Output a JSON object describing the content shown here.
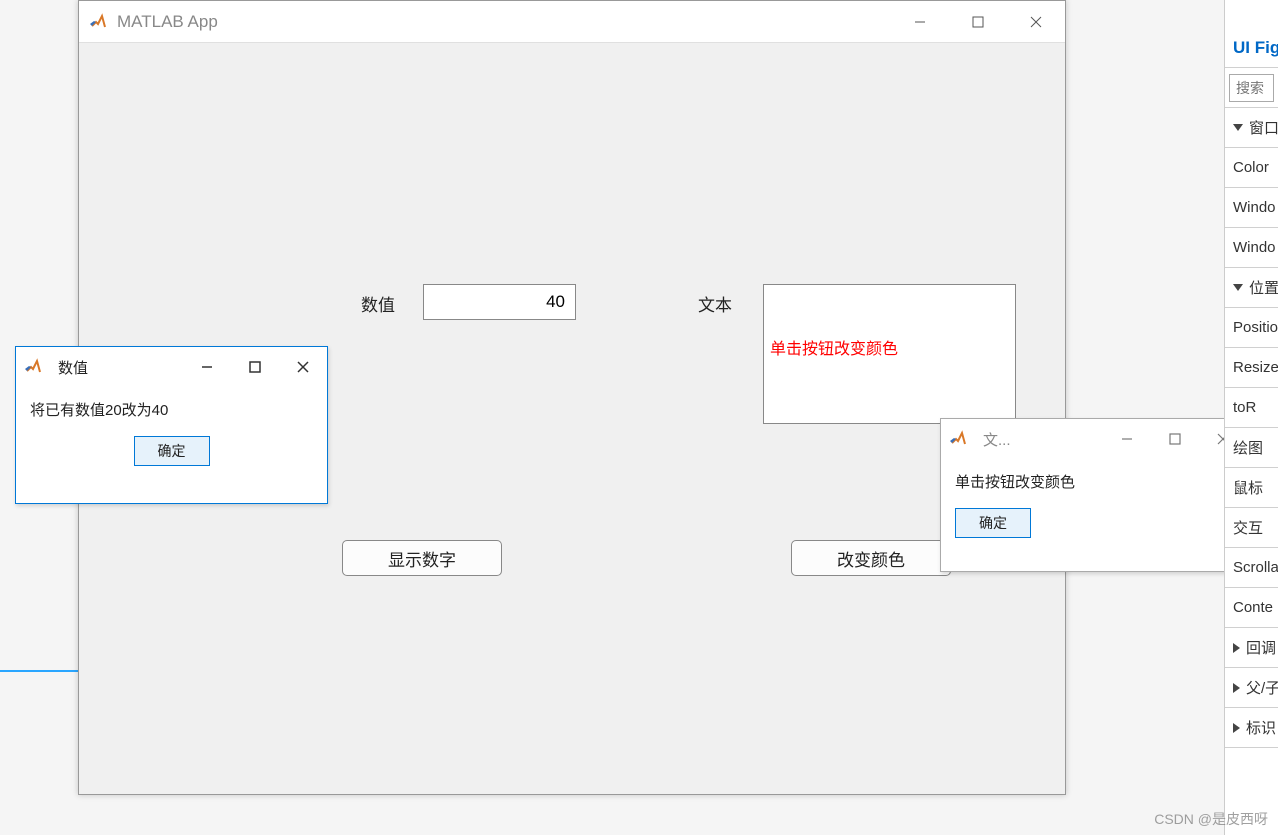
{
  "main_window": {
    "title": "MATLAB App",
    "labels": {
      "numeric": "数值",
      "text": "文本"
    },
    "numeric_value": "40",
    "textarea_value": "单击按钮改变颜色",
    "buttons": {
      "show_number": "显示数字",
      "change_color": "改变颜色"
    }
  },
  "dialog_numeric": {
    "title": "数值",
    "message": "将已有数值20改为40",
    "ok": "确定"
  },
  "dialog_text": {
    "title": "文...",
    "message": "单击按钮改变颜色",
    "ok": "确定"
  },
  "prop_panel": {
    "header": "UI Figu",
    "search_placeholder": "搜索",
    "sections": {
      "window": "窗口",
      "position_section": "位置",
      "callback": "回调",
      "parent": "父/子",
      "ident": "标识"
    },
    "props": {
      "color": "Color",
      "windo1": "Windo",
      "windo2": "Windo",
      "position": "Positio",
      "resize": "Resize",
      "tor": "toR",
      "plotting": "绘图",
      "mouse": "鼠标",
      "interact": "交互",
      "scrolla": "Scrolla",
      "conte": "Conte"
    }
  },
  "watermark": "CSDN @是皮西呀"
}
